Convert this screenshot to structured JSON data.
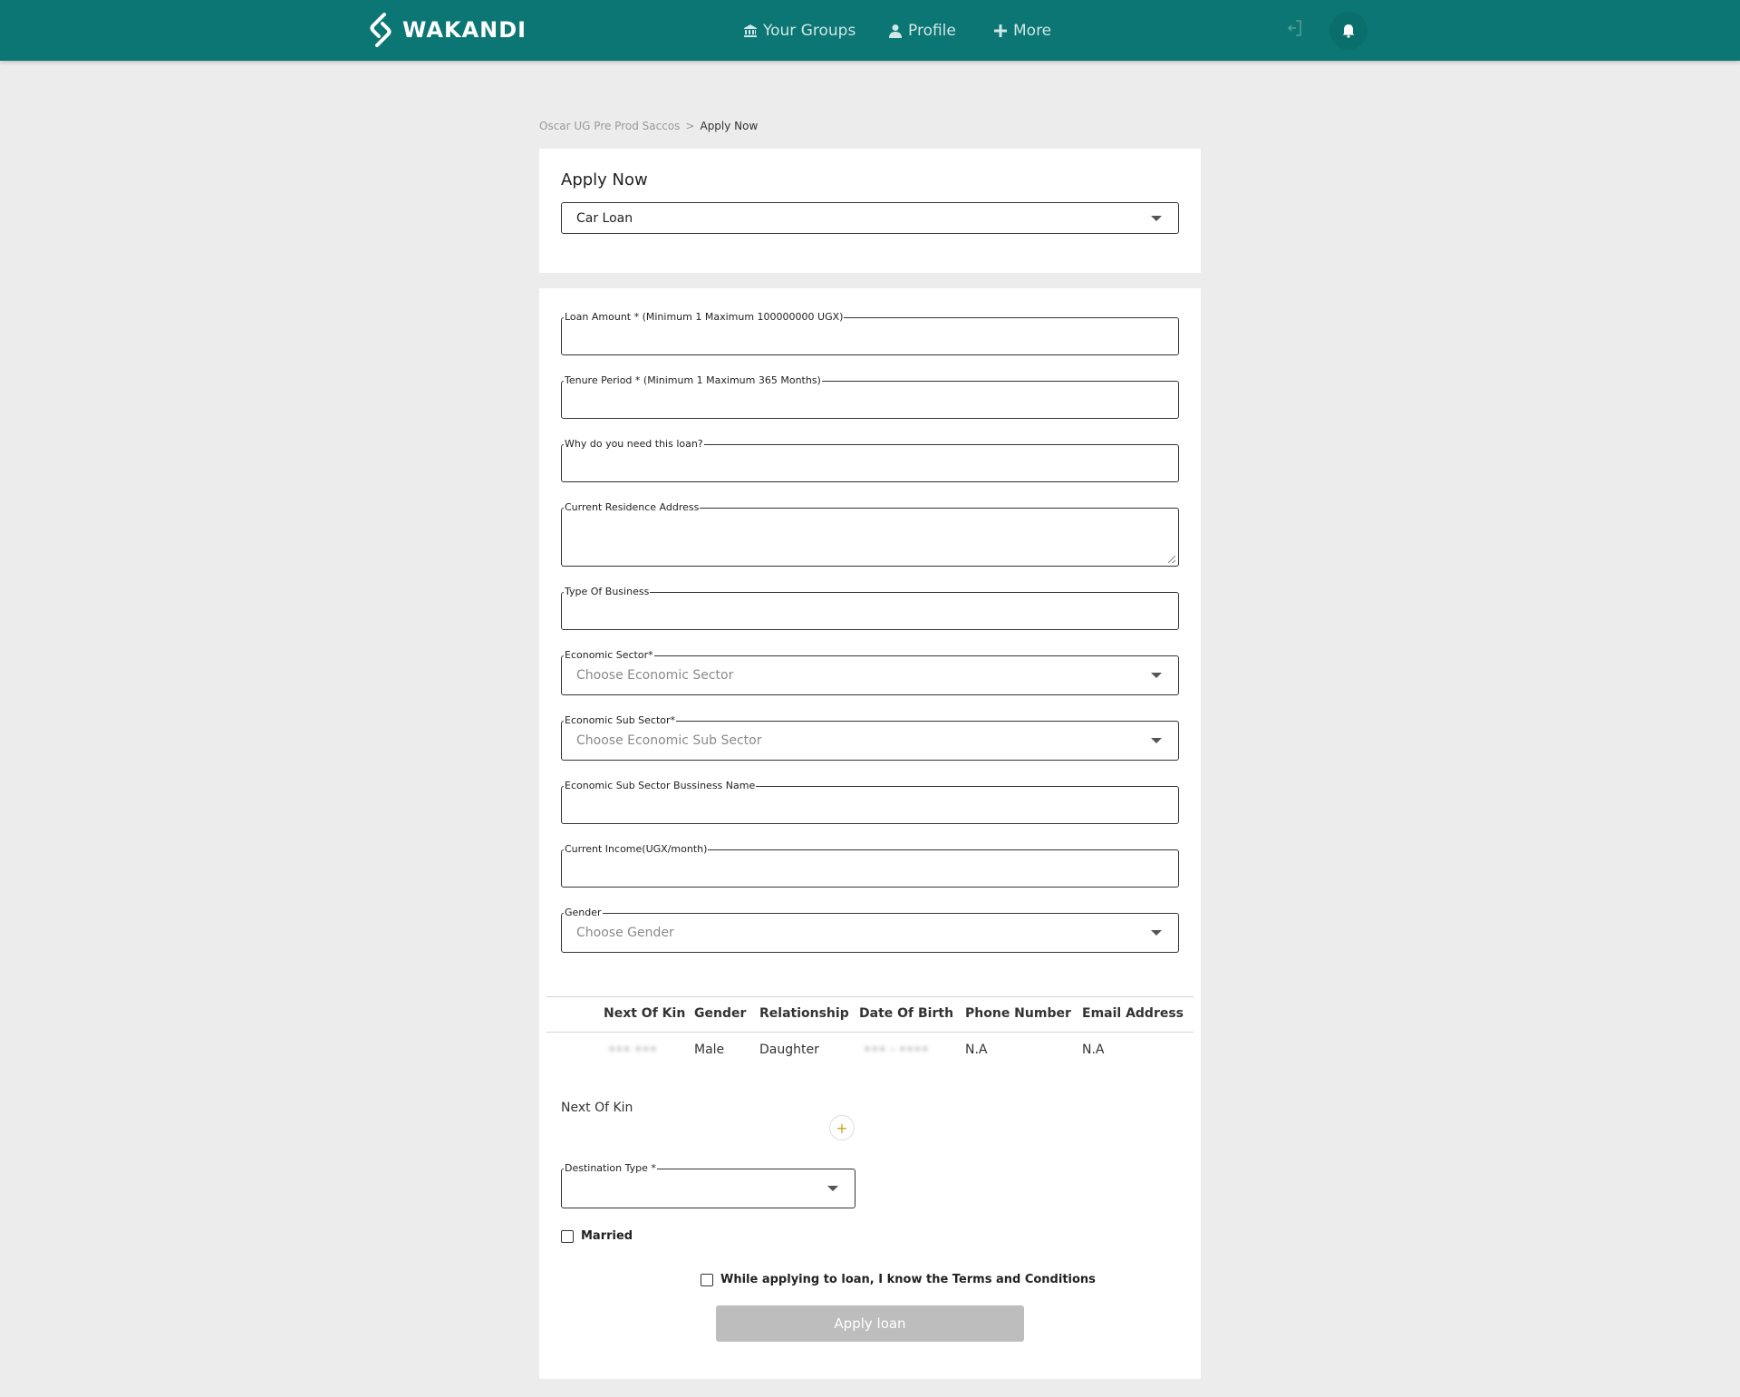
{
  "header": {
    "brand": "WAKANDI",
    "nav": {
      "groups": "Your Groups",
      "profile": "Profile",
      "more": "More"
    }
  },
  "breadcrumb": {
    "parent": "Oscar UG Pre Prod Saccos",
    "separator": ">",
    "current": "Apply Now"
  },
  "apply": {
    "title": "Apply Now",
    "loan_type": "Car Loan"
  },
  "form": {
    "loan_amount_label": "Loan Amount * (Minimum 1 Maximum 100000000 UGX)",
    "tenure_label": "Tenure Period * (Minimum 1 Maximum 365 Months)",
    "reason_label": "Why do you need this loan?",
    "residence_label": "Current Residence Address",
    "business_type_label": "Type Of Business",
    "sector_label": "Economic Sector*",
    "sector_placeholder": "Choose Economic Sector",
    "sub_sector_label": "Economic Sub Sector*",
    "sub_sector_placeholder": "Choose Economic Sub Sector",
    "sub_sector_business_label": "Economic Sub Sector Bussiness Name",
    "income_label": "Current Income(UGX/month)",
    "gender_label": "Gender",
    "gender_placeholder": "Choose Gender"
  },
  "kin_table": {
    "headers": [
      "Next Of Kin",
      "Gender",
      "Relationship",
      "Date Of Birth",
      "Phone Number",
      "Email Address"
    ],
    "rows": [
      {
        "name": "••• •••",
        "gender": "Male",
        "relationship": "Daughter",
        "dob": "•••  -  ••••",
        "phone": "N.A",
        "email": "N.A"
      }
    ]
  },
  "next_of_kin_label": "Next Of Kin",
  "add_symbol": "+",
  "destination_label": "Destination Type *",
  "married_label": "Married",
  "terms_label": "While applying to loan, I know the Terms and Conditions",
  "apply_button": "Apply loan",
  "colors": {
    "header_bg": "#0b7673",
    "page_bg": "#ececec",
    "button_disabled": "#bdbdbd",
    "accent_plus": "#c9a227"
  },
  "icons": [
    "wakandi-logo-icon",
    "bank-icon",
    "user-icon",
    "plus-icon",
    "logout-icon",
    "bell-icon",
    "chevron-down-icon"
  ]
}
